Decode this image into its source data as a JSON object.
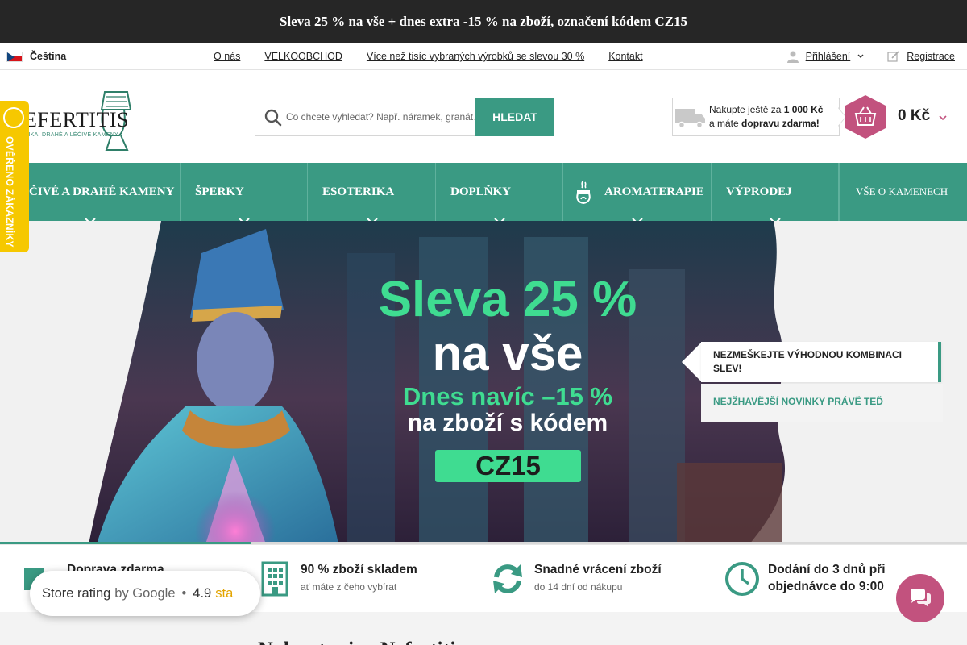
{
  "promo_bar": {
    "text": "Sleva 25 % na vše + dnes extra -15 % na zboží, označení kódem CZ15"
  },
  "utility": {
    "language": "Čeština",
    "links": [
      "O nás",
      "VELKOOBCHOD",
      "Více než tisíc vybraných výrobků se slevou 30 %",
      "Kontakt"
    ],
    "login": "Přihlášení",
    "register": "Registrace"
  },
  "logo": {
    "text": "EFERTITIS",
    "tagline": "RIKA, DRAHÉ A LÉČIVÉ KAMENY"
  },
  "verified_badge": {
    "text": "OVĚŘENO ZÁKAZNÍKY"
  },
  "search": {
    "placeholder": "Co chcete vyhledat? Např. náramek, granát…",
    "button": "HLEDAT"
  },
  "shipping": {
    "line1_prefix": "Nakupte ještě za",
    "amount": "1 000 Kč",
    "line2_prefix": "a máte",
    "line2_strong": "dopravu zdarma!"
  },
  "cart": {
    "total": "0 Kč"
  },
  "nav": {
    "items": [
      {
        "label": "ČIVÉ A DRAHÉ KAMENY"
      },
      {
        "label": "ŠPERKY"
      },
      {
        "label": "ESOTERIKA"
      },
      {
        "label": "DOPLŇKY"
      },
      {
        "label": "AROMATERAPIE"
      },
      {
        "label": "VÝPRODEJ"
      },
      {
        "label": "VŠE O KAMENECH"
      }
    ]
  },
  "hero": {
    "line1": "Sleva 25 %",
    "line2": "na vše",
    "line3": "Dnes navíc –15 %",
    "line4": "na zboží s kódem",
    "code": "CZ15",
    "progress": 0.26
  },
  "hero_tabs": {
    "active": "NEZMEŠKEJTE VÝHODNOU KOMBINACI SLEV!",
    "second": "NEJŽHAVĚJŠÍ NOVINKY PRÁVĚ TEĎ"
  },
  "usp": [
    {
      "title": "Doprava zdarma",
      "sub": ""
    },
    {
      "title": "90 % zboží skladem",
      "sub": "ať máte z čeho vybírat"
    },
    {
      "title": "Snadné vrácení zboží",
      "sub": "do 14 dní od nákupu"
    },
    {
      "title": "Dodání do 3 dnů při objednávce do 9:00",
      "title_line1": "Dodání do 3 dnů při",
      "title_line2": "objednávce do 9:00",
      "sub": ""
    }
  ],
  "rating": {
    "label": "Store rating",
    "by": "by Google",
    "score": "4.9",
    "stars": "sta"
  },
  "lower": {
    "heading": "Nakupte si ... Nefertiti"
  },
  "colors": {
    "accent": "#3a9a83",
    "promo_bg": "#262626",
    "hero_green": "#3fdc91",
    "chat_pink": "#c2527e",
    "badge_yellow": "#f6c800"
  }
}
